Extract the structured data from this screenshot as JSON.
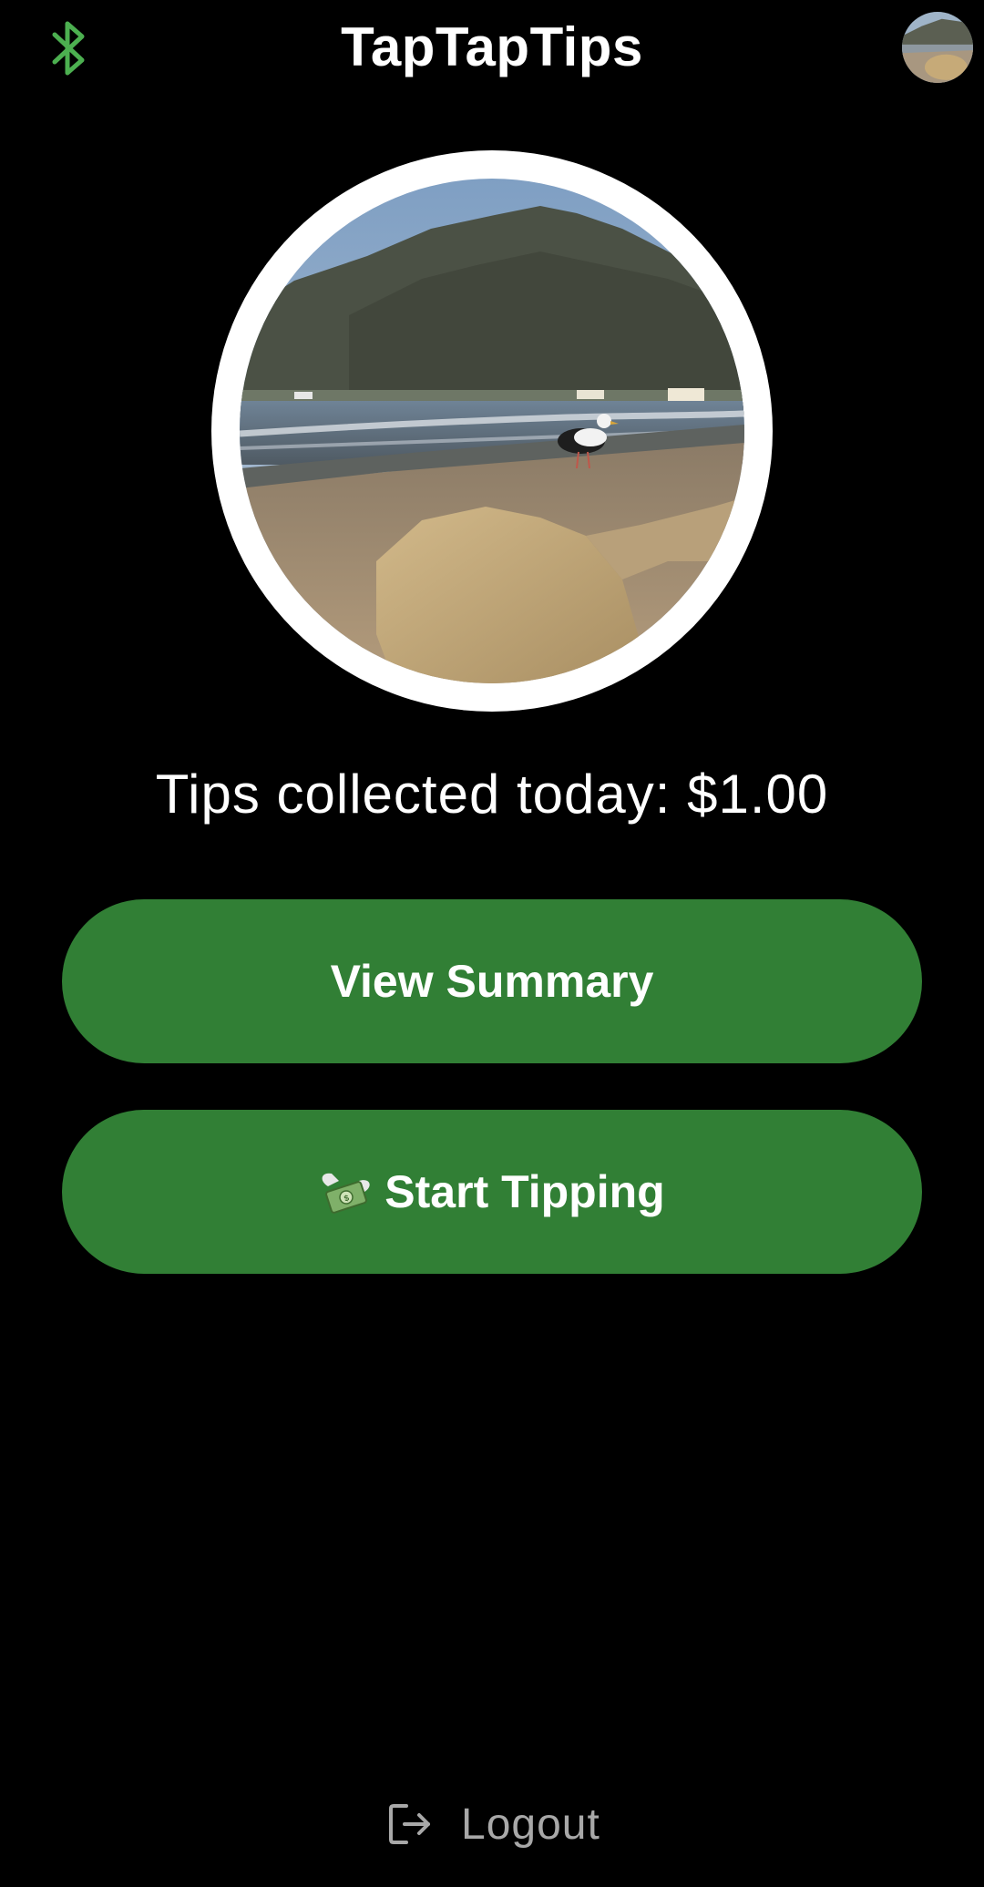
{
  "header": {
    "title": "TapTapTips",
    "bluetooth_icon": "bluetooth-icon",
    "bluetooth_color": "#4caf50",
    "avatar_icon": "user-avatar"
  },
  "profile": {
    "photo": "beach-seagull-photo"
  },
  "tips": {
    "label": "Tips collected today: $1.00"
  },
  "buttons": {
    "view_summary": "View Summary",
    "start_tipping": "Start Tipping",
    "start_tipping_icon": "money-with-wings-icon",
    "color": "#317f35"
  },
  "footer": {
    "logout_label": "Logout",
    "logout_icon": "logout-icon"
  }
}
